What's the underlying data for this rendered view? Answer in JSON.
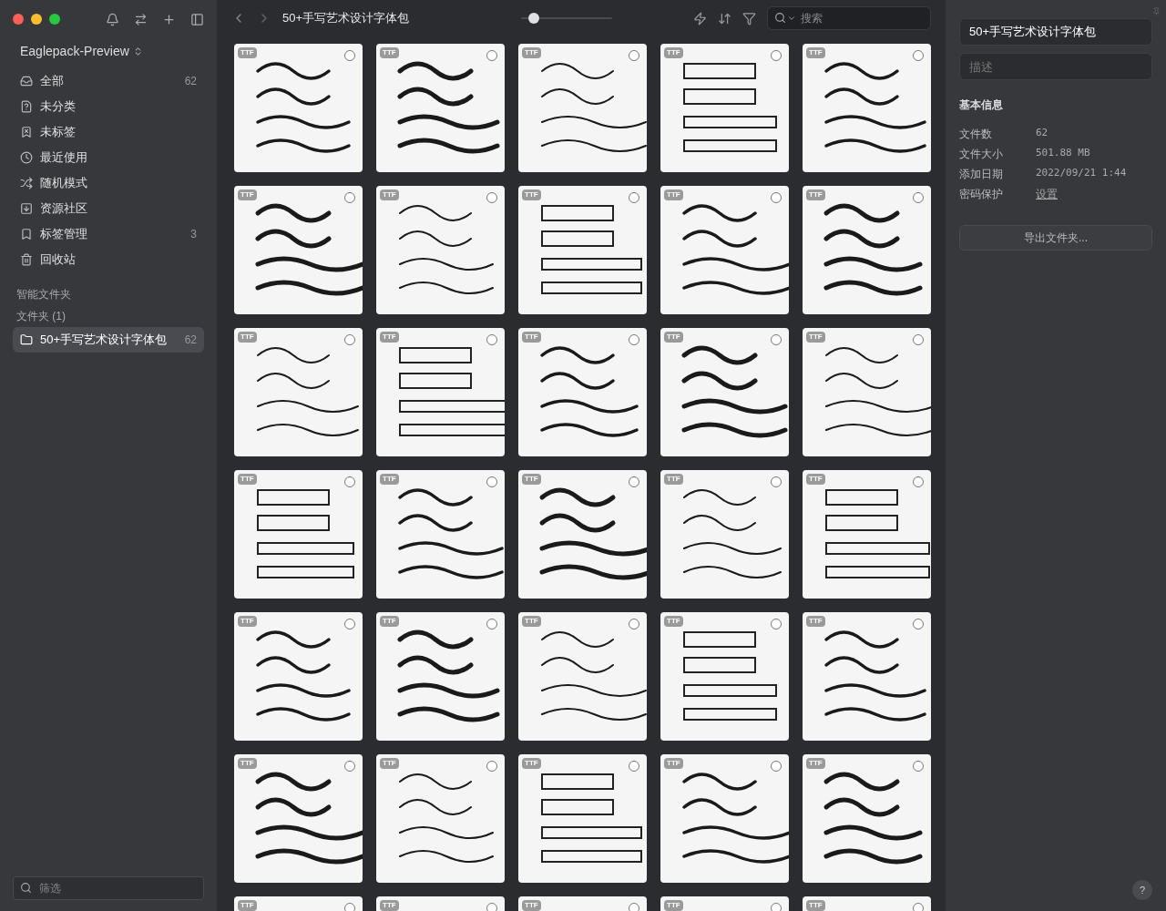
{
  "sidebar": {
    "library": "Eaglepack-Preview",
    "items": [
      {
        "kind": "all",
        "label": "全部",
        "count": "62"
      },
      {
        "kind": "unfiled",
        "label": "未分类"
      },
      {
        "kind": "untagged",
        "label": "未标签"
      },
      {
        "kind": "recent",
        "label": "最近使用"
      },
      {
        "kind": "random",
        "label": "随机模式"
      },
      {
        "kind": "community",
        "label": "资源社区"
      },
      {
        "kind": "tags",
        "label": "标签管理",
        "count": "3"
      },
      {
        "kind": "trash",
        "label": "回收站"
      }
    ],
    "smart_folders_heading": "智能文件夹",
    "folders_heading": "文件夹 (1)",
    "folders": [
      {
        "label": "50+手写艺术设计字体包",
        "count": "62",
        "selected": true
      }
    ],
    "filter": {
      "placeholder": "筛选"
    }
  },
  "toolbar": {
    "title": "50+手写艺术设计字体包",
    "zoom": {
      "level": 0.14
    },
    "search": {
      "placeholder": "搜索"
    }
  },
  "grid": {
    "cards": [
      {
        "badge": "TTF",
        "selected": false
      },
      {
        "badge": "TTF",
        "selected": false
      },
      {
        "badge": "TTF",
        "selected": false
      },
      {
        "badge": "TTF",
        "selected": false
      },
      {
        "badge": "TTF",
        "selected": false
      },
      {
        "badge": "TTF",
        "selected": false
      },
      {
        "badge": "TTF",
        "selected": false
      },
      {
        "badge": "TTF",
        "selected": false
      },
      {
        "badge": "TTF",
        "selected": false
      },
      {
        "badge": "TTF",
        "selected": false
      },
      {
        "badge": "TTF",
        "selected": false
      },
      {
        "badge": "TTF",
        "selected": false
      },
      {
        "badge": "TTF",
        "selected": false
      },
      {
        "badge": "TTF",
        "selected": false
      },
      {
        "badge": "TTF",
        "selected": false
      },
      {
        "badge": "TTF",
        "selected": false
      },
      {
        "badge": "TTF",
        "selected": false
      },
      {
        "badge": "TTF",
        "selected": false
      },
      {
        "badge": "TTF",
        "selected": false
      },
      {
        "badge": "TTF",
        "selected": false
      },
      {
        "badge": "TTF",
        "selected": false
      },
      {
        "badge": "TTF",
        "selected": false
      },
      {
        "badge": "TTF",
        "selected": false
      },
      {
        "badge": "TTF",
        "selected": false
      },
      {
        "badge": "TTF",
        "selected": false
      },
      {
        "badge": "TTF",
        "selected": false
      },
      {
        "badge": "TTF",
        "selected": false
      },
      {
        "badge": "TTF",
        "selected": false
      },
      {
        "badge": "TTF",
        "selected": false
      },
      {
        "badge": "TTF",
        "selected": false
      },
      {
        "badge": "TTF",
        "selected": false
      },
      {
        "badge": "TTF",
        "selected": false
      },
      {
        "badge": "TTF",
        "selected": false
      },
      {
        "badge": "TTF",
        "selected": false
      },
      {
        "badge": "TTF",
        "selected": false
      }
    ]
  },
  "inspector": {
    "name": "50+手写艺术设计字体包",
    "description": {
      "placeholder": "描述"
    },
    "heading": "基本信息",
    "fields": [
      {
        "label": "文件数",
        "value": "62"
      },
      {
        "label": "文件大小",
        "value": "501.88 MB"
      },
      {
        "label": "添加日期",
        "value": "2022/09/21 1:44"
      },
      {
        "label": "密码保护",
        "value": "设置",
        "kind": "link"
      }
    ],
    "export_button": "导出文件夹...",
    "help": "?"
  }
}
